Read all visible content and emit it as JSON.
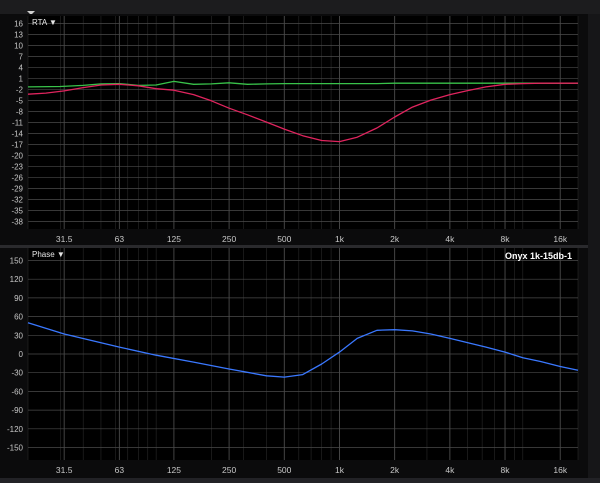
{
  "panels": {
    "rta": {
      "menu_label": "RTA ▼"
    },
    "phase": {
      "menu_label": "Phase ▼",
      "trace_name": "Onyx 1k-15db-1"
    }
  },
  "colors": {
    "background": "#000000",
    "grid_minor": "#2a2a2a",
    "grid_major": "#4a4a4a",
    "axis_text": "#c8c8c8",
    "green_trace": "#39c24a",
    "red_trace": "#e0245e",
    "blue_trace": "#3a78ff"
  },
  "chart_data": [
    {
      "type": "line",
      "x_scale": "log",
      "x_ticks": [
        "31.5",
        "63",
        "125",
        "250",
        "500",
        "1k",
        "2k",
        "4k",
        "8k",
        "16k"
      ],
      "xlim": [
        20,
        20000
      ],
      "y_ticks": [
        16,
        13,
        10,
        7,
        4,
        1,
        -2,
        -5,
        -8,
        -11,
        -14,
        -17,
        -20,
        -23,
        -26,
        -29,
        -32,
        -35,
        -38
      ],
      "ylim": [
        -40,
        18
      ],
      "grid": true,
      "series": [
        {
          "color": "green",
          "x": [
            20,
            30,
            40,
            50,
            63,
            80,
            100,
            125,
            160,
            200,
            250,
            315,
            400,
            500,
            630,
            800,
            1000,
            1250,
            1600,
            2000,
            2500,
            3150,
            4000,
            5000,
            6300,
            8000,
            10000,
            12500,
            16000,
            20000
          ],
          "y": [
            -1.3,
            -1.2,
            -0.9,
            -0.5,
            -0.4,
            -0.9,
            -0.8,
            0.2,
            -0.6,
            -0.5,
            -0.2,
            -0.6,
            -0.5,
            -0.4,
            -0.4,
            -0.4,
            -0.4,
            -0.4,
            -0.4,
            -0.3,
            -0.3,
            -0.3,
            -0.3,
            -0.3,
            -0.3,
            -0.3,
            -0.3,
            -0.3,
            -0.3,
            -0.3
          ]
        },
        {
          "color": "red",
          "x": [
            20,
            25,
            31.5,
            40,
            50,
            63,
            80,
            100,
            125,
            160,
            200,
            250,
            315,
            400,
            500,
            630,
            800,
            1000,
            1250,
            1600,
            2000,
            2500,
            3150,
            4000,
            5000,
            6300,
            8000,
            10000,
            12500,
            16000,
            20000
          ],
          "y": [
            -3.3,
            -3.0,
            -2.4,
            -1.5,
            -0.8,
            -0.6,
            -1.0,
            -1.8,
            -2.2,
            -3.4,
            -5.1,
            -7.1,
            -8.9,
            -10.9,
            -12.8,
            -14.6,
            -15.9,
            -16.2,
            -15.0,
            -12.5,
            -9.5,
            -6.8,
            -4.9,
            -3.4,
            -2.3,
            -1.3,
            -0.6,
            -0.4,
            -0.3,
            -0.3,
            -0.3
          ]
        }
      ]
    },
    {
      "type": "line",
      "x_scale": "log",
      "x_ticks": [
        "31.5",
        "63",
        "125",
        "250",
        "500",
        "1k",
        "2k",
        "4k",
        "8k",
        "16k"
      ],
      "xlim": [
        20,
        20000
      ],
      "y_ticks": [
        150,
        120,
        90,
        60,
        30,
        0,
        -30,
        -60,
        -90,
        -120,
        -150
      ],
      "ylim": [
        -170,
        170
      ],
      "grid": true,
      "series": [
        {
          "name": "Onyx 1k-15db-1",
          "color": "blue",
          "x": [
            20,
            31.5,
            50,
            63,
            100,
            160,
            250,
            400,
            500,
            630,
            800,
            1000,
            1250,
            1600,
            2000,
            2500,
            3150,
            4000,
            6300,
            8000,
            10000,
            12500,
            16000,
            20000
          ],
          "y": [
            50,
            32,
            18,
            11,
            -2,
            -13,
            -24,
            -35,
            -37,
            -33,
            -16,
            3,
            25,
            38,
            39,
            37,
            32,
            25,
            11,
            3,
            -6,
            -12,
            -20,
            -26
          ]
        }
      ]
    }
  ]
}
